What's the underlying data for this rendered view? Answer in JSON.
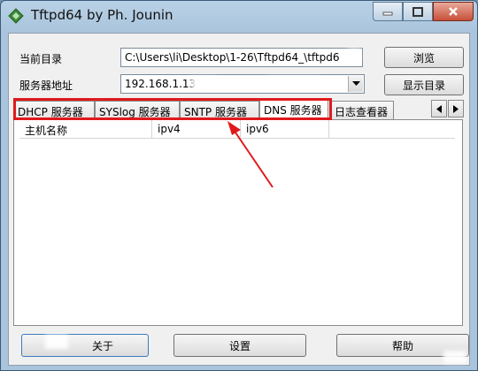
{
  "window": {
    "title": "Tftpd64 by Ph. Jounin"
  },
  "form": {
    "current_dir_label": "当前目录",
    "current_dir_value": "C:\\Users\\li\\Desktop\\1-26\\Tftpd64_\\tftpd6",
    "server_addr_label": "服务器地址",
    "server_addr_value": "192.168.1.13",
    "browse_button": "浏览",
    "show_dir_button": "显示目录"
  },
  "tabs": [
    {
      "label": "DHCP 服务器"
    },
    {
      "label": "SYSlog 服务器"
    },
    {
      "label": "SNTP 服务器"
    },
    {
      "label": "DNS 服务器",
      "active": true
    },
    {
      "label": "日志查看器"
    }
  ],
  "list": {
    "columns": [
      "主机名称",
      "ipv4",
      "ipv6"
    ]
  },
  "footer": {
    "about_button": "关于",
    "settings_button": "设置",
    "help_button": "帮助"
  },
  "icons": [
    "app-icon",
    "minimize-icon",
    "maximize-icon",
    "close-icon",
    "chevron-down-icon",
    "arrow-left-icon",
    "arrow-right-icon"
  ],
  "colors": {
    "highlight": "#e0191d",
    "annotation_arrow": "#e0191d"
  }
}
